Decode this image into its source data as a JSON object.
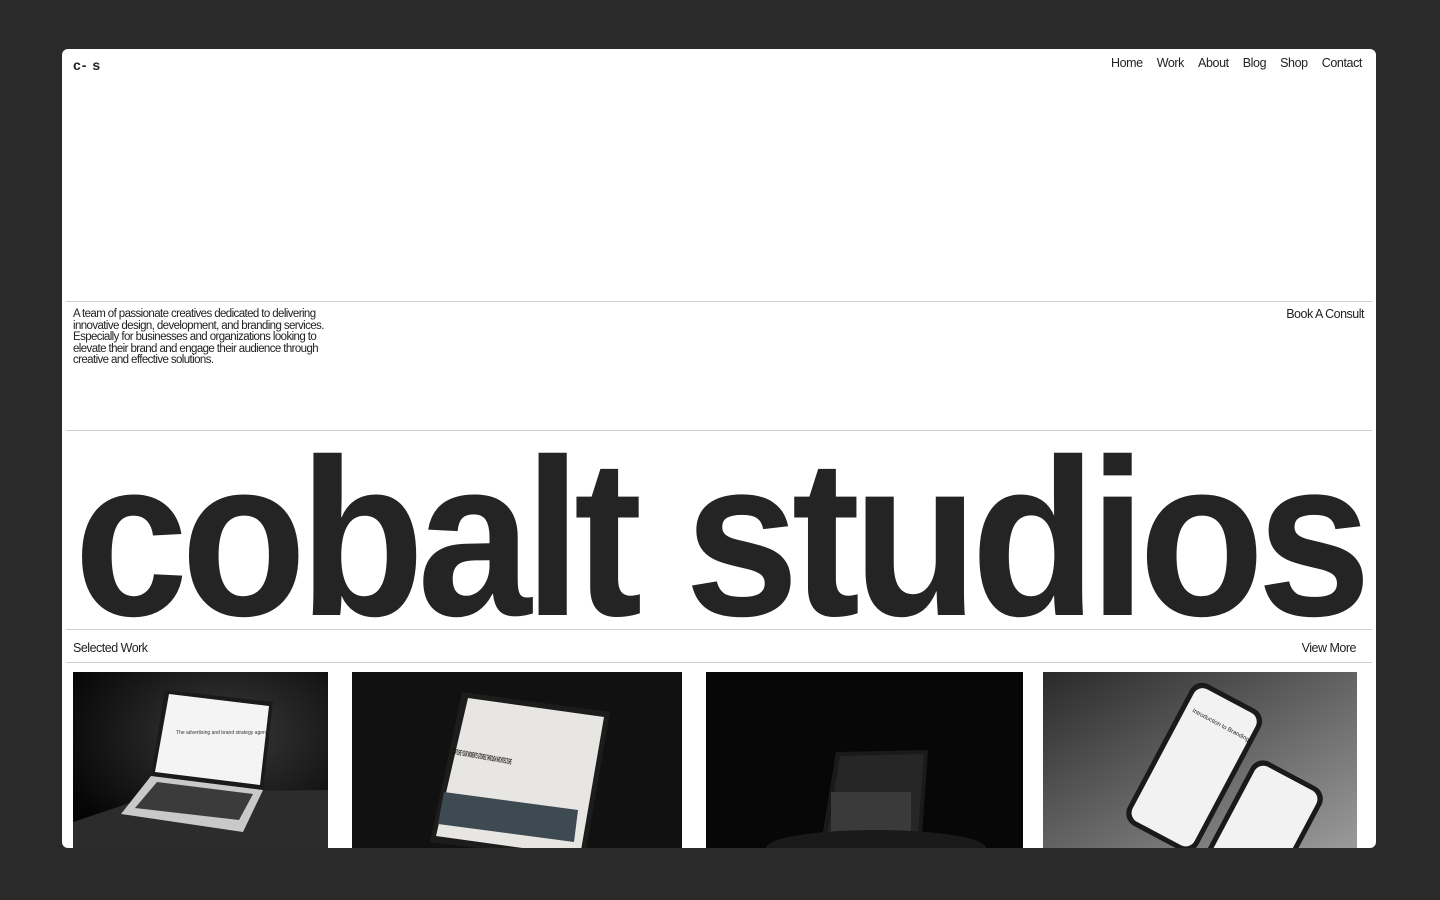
{
  "header": {
    "logo": "c- s",
    "nav": [
      "Home",
      "Work",
      "About",
      "Blog",
      "Shop",
      "Contact"
    ]
  },
  "intro": {
    "text": "A team of passionate creatives dedicated to delivering innovative design, development, and branding services. Especially for businesses and organizations looking to elevate their brand and engage their audience through creative and effective solutions.",
    "cta": "Book A Consult"
  },
  "hero": {
    "title": "cobalt studios"
  },
  "work": {
    "heading": "Selected Work",
    "view_more": "View More",
    "cards": [
      {
        "name": "laptop-mockup",
        "screen_text": "The advertising and brand strategy agency"
      },
      {
        "name": "tablet-mockup",
        "screen_text": "CAPTURE YOUR MOMENTS STORIES THROUGH ARCHITECTURE"
      },
      {
        "name": "dark-tablet-mockup",
        "screen_text": ""
      },
      {
        "name": "phones-mockup",
        "screen_text": "Introduction to Branding"
      }
    ]
  },
  "colors": {
    "background": "#2a2a2a",
    "page": "#ffffff",
    "text": "#222222",
    "rule": "#cfcfcf"
  }
}
